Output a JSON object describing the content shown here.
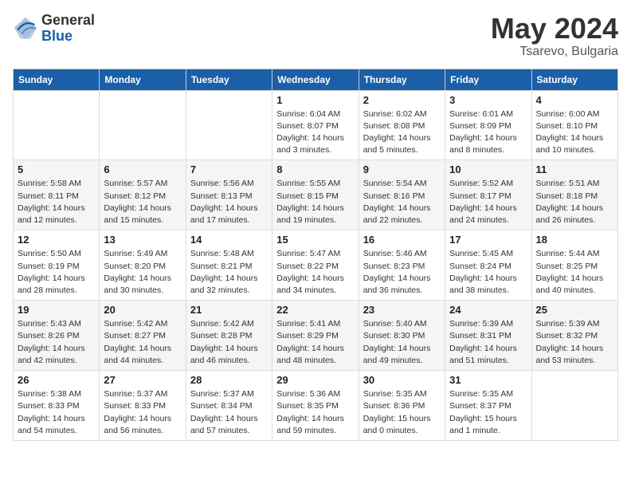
{
  "logo": {
    "general": "General",
    "blue": "Blue"
  },
  "title": {
    "month_year": "May 2024",
    "location": "Tsarevo, Bulgaria"
  },
  "days_of_week": [
    "Sunday",
    "Monday",
    "Tuesday",
    "Wednesday",
    "Thursday",
    "Friday",
    "Saturday"
  ],
  "weeks": [
    [
      {
        "day": "",
        "info": ""
      },
      {
        "day": "",
        "info": ""
      },
      {
        "day": "",
        "info": ""
      },
      {
        "day": "1",
        "info": "Sunrise: 6:04 AM\nSunset: 8:07 PM\nDaylight: 14 hours\nand 3 minutes."
      },
      {
        "day": "2",
        "info": "Sunrise: 6:02 AM\nSunset: 8:08 PM\nDaylight: 14 hours\nand 5 minutes."
      },
      {
        "day": "3",
        "info": "Sunrise: 6:01 AM\nSunset: 8:09 PM\nDaylight: 14 hours\nand 8 minutes."
      },
      {
        "day": "4",
        "info": "Sunrise: 6:00 AM\nSunset: 8:10 PM\nDaylight: 14 hours\nand 10 minutes."
      }
    ],
    [
      {
        "day": "5",
        "info": "Sunrise: 5:58 AM\nSunset: 8:11 PM\nDaylight: 14 hours\nand 12 minutes."
      },
      {
        "day": "6",
        "info": "Sunrise: 5:57 AM\nSunset: 8:12 PM\nDaylight: 14 hours\nand 15 minutes."
      },
      {
        "day": "7",
        "info": "Sunrise: 5:56 AM\nSunset: 8:13 PM\nDaylight: 14 hours\nand 17 minutes."
      },
      {
        "day": "8",
        "info": "Sunrise: 5:55 AM\nSunset: 8:15 PM\nDaylight: 14 hours\nand 19 minutes."
      },
      {
        "day": "9",
        "info": "Sunrise: 5:54 AM\nSunset: 8:16 PM\nDaylight: 14 hours\nand 22 minutes."
      },
      {
        "day": "10",
        "info": "Sunrise: 5:52 AM\nSunset: 8:17 PM\nDaylight: 14 hours\nand 24 minutes."
      },
      {
        "day": "11",
        "info": "Sunrise: 5:51 AM\nSunset: 8:18 PM\nDaylight: 14 hours\nand 26 minutes."
      }
    ],
    [
      {
        "day": "12",
        "info": "Sunrise: 5:50 AM\nSunset: 8:19 PM\nDaylight: 14 hours\nand 28 minutes."
      },
      {
        "day": "13",
        "info": "Sunrise: 5:49 AM\nSunset: 8:20 PM\nDaylight: 14 hours\nand 30 minutes."
      },
      {
        "day": "14",
        "info": "Sunrise: 5:48 AM\nSunset: 8:21 PM\nDaylight: 14 hours\nand 32 minutes."
      },
      {
        "day": "15",
        "info": "Sunrise: 5:47 AM\nSunset: 8:22 PM\nDaylight: 14 hours\nand 34 minutes."
      },
      {
        "day": "16",
        "info": "Sunrise: 5:46 AM\nSunset: 8:23 PM\nDaylight: 14 hours\nand 36 minutes."
      },
      {
        "day": "17",
        "info": "Sunrise: 5:45 AM\nSunset: 8:24 PM\nDaylight: 14 hours\nand 38 minutes."
      },
      {
        "day": "18",
        "info": "Sunrise: 5:44 AM\nSunset: 8:25 PM\nDaylight: 14 hours\nand 40 minutes."
      }
    ],
    [
      {
        "day": "19",
        "info": "Sunrise: 5:43 AM\nSunset: 8:26 PM\nDaylight: 14 hours\nand 42 minutes."
      },
      {
        "day": "20",
        "info": "Sunrise: 5:42 AM\nSunset: 8:27 PM\nDaylight: 14 hours\nand 44 minutes."
      },
      {
        "day": "21",
        "info": "Sunrise: 5:42 AM\nSunset: 8:28 PM\nDaylight: 14 hours\nand 46 minutes."
      },
      {
        "day": "22",
        "info": "Sunrise: 5:41 AM\nSunset: 8:29 PM\nDaylight: 14 hours\nand 48 minutes."
      },
      {
        "day": "23",
        "info": "Sunrise: 5:40 AM\nSunset: 8:30 PM\nDaylight: 14 hours\nand 49 minutes."
      },
      {
        "day": "24",
        "info": "Sunrise: 5:39 AM\nSunset: 8:31 PM\nDaylight: 14 hours\nand 51 minutes."
      },
      {
        "day": "25",
        "info": "Sunrise: 5:39 AM\nSunset: 8:32 PM\nDaylight: 14 hours\nand 53 minutes."
      }
    ],
    [
      {
        "day": "26",
        "info": "Sunrise: 5:38 AM\nSunset: 8:33 PM\nDaylight: 14 hours\nand 54 minutes."
      },
      {
        "day": "27",
        "info": "Sunrise: 5:37 AM\nSunset: 8:33 PM\nDaylight: 14 hours\nand 56 minutes."
      },
      {
        "day": "28",
        "info": "Sunrise: 5:37 AM\nSunset: 8:34 PM\nDaylight: 14 hours\nand 57 minutes."
      },
      {
        "day": "29",
        "info": "Sunrise: 5:36 AM\nSunset: 8:35 PM\nDaylight: 14 hours\nand 59 minutes."
      },
      {
        "day": "30",
        "info": "Sunrise: 5:35 AM\nSunset: 8:36 PM\nDaylight: 15 hours\nand 0 minutes."
      },
      {
        "day": "31",
        "info": "Sunrise: 5:35 AM\nSunset: 8:37 PM\nDaylight: 15 hours\nand 1 minute."
      },
      {
        "day": "",
        "info": ""
      }
    ]
  ]
}
